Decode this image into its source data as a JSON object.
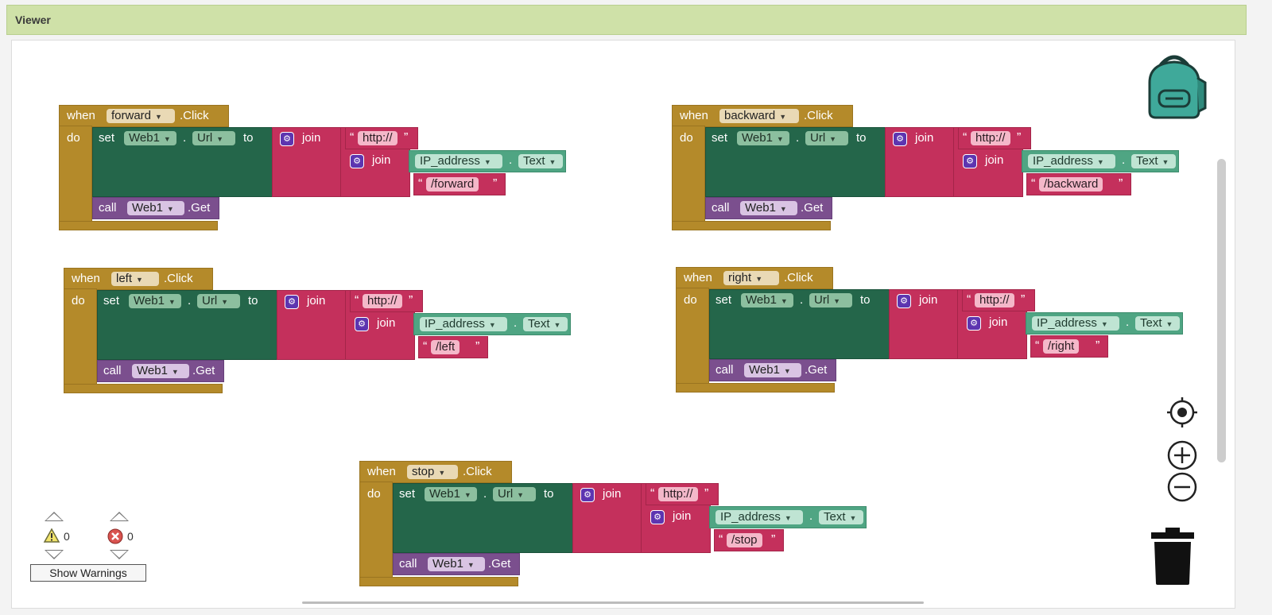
{
  "viewer": {
    "title": "Viewer"
  },
  "blocks": [
    {
      "when": "when",
      "do": "do",
      "component": "forward",
      "event": ".Click",
      "set": "set",
      "web": "Web1",
      "dot": ".",
      "prop": "Url",
      "to": "to",
      "join": "join",
      "http": "http://",
      "ip": "IP_address",
      "text": "Text",
      "path": "/forward",
      "call": "call",
      "get": ".Get"
    },
    {
      "when": "when",
      "do": "do",
      "component": "backward",
      "event": ".Click",
      "set": "set",
      "web": "Web1",
      "dot": ".",
      "prop": "Url",
      "to": "to",
      "join": "join",
      "http": "http://",
      "ip": "IP_address",
      "text": "Text",
      "path": "/backward",
      "call": "call",
      "get": ".Get"
    },
    {
      "when": "when",
      "do": "do",
      "component": "left",
      "event": ".Click",
      "set": "set",
      "web": "Web1",
      "dot": ".",
      "prop": "Url",
      "to": "to",
      "join": "join",
      "http": "http://",
      "ip": "IP_address",
      "text": "Text",
      "path": "/left",
      "call": "call",
      "get": ".Get"
    },
    {
      "when": "when",
      "do": "do",
      "component": "right",
      "event": ".Click",
      "set": "set",
      "web": "Web1",
      "dot": ".",
      "prop": "Url",
      "to": "to",
      "join": "join",
      "http": "http://",
      "ip": "IP_address",
      "text": "Text",
      "path": "/right",
      "call": "call",
      "get": ".Get"
    },
    {
      "when": "when",
      "do": "do",
      "component": "stop",
      "event": ".Click",
      "set": "set",
      "web": "Web1",
      "dot": ".",
      "prop": "Url",
      "to": "to",
      "join": "join",
      "http": "http://",
      "ip": "IP_address",
      "text": "Text",
      "path": "/stop",
      "call": "call",
      "get": ".Get"
    }
  ],
  "warnings": {
    "warning_count": "0",
    "error_count": "0",
    "show_label": "Show Warnings"
  },
  "icons": {
    "backpack": "backpack-icon",
    "center": "target-icon",
    "zoom_in": "plus-circle-icon",
    "zoom_out": "minus-circle-icon",
    "trash": "trash-icon",
    "warning": "warning-triangle-icon",
    "error": "error-circle-icon"
  },
  "colors": {
    "event": "#b48a2a",
    "setter": "#24664a",
    "text": "#c4305c",
    "call": "#7b4f8e",
    "component": "#4fa583"
  }
}
